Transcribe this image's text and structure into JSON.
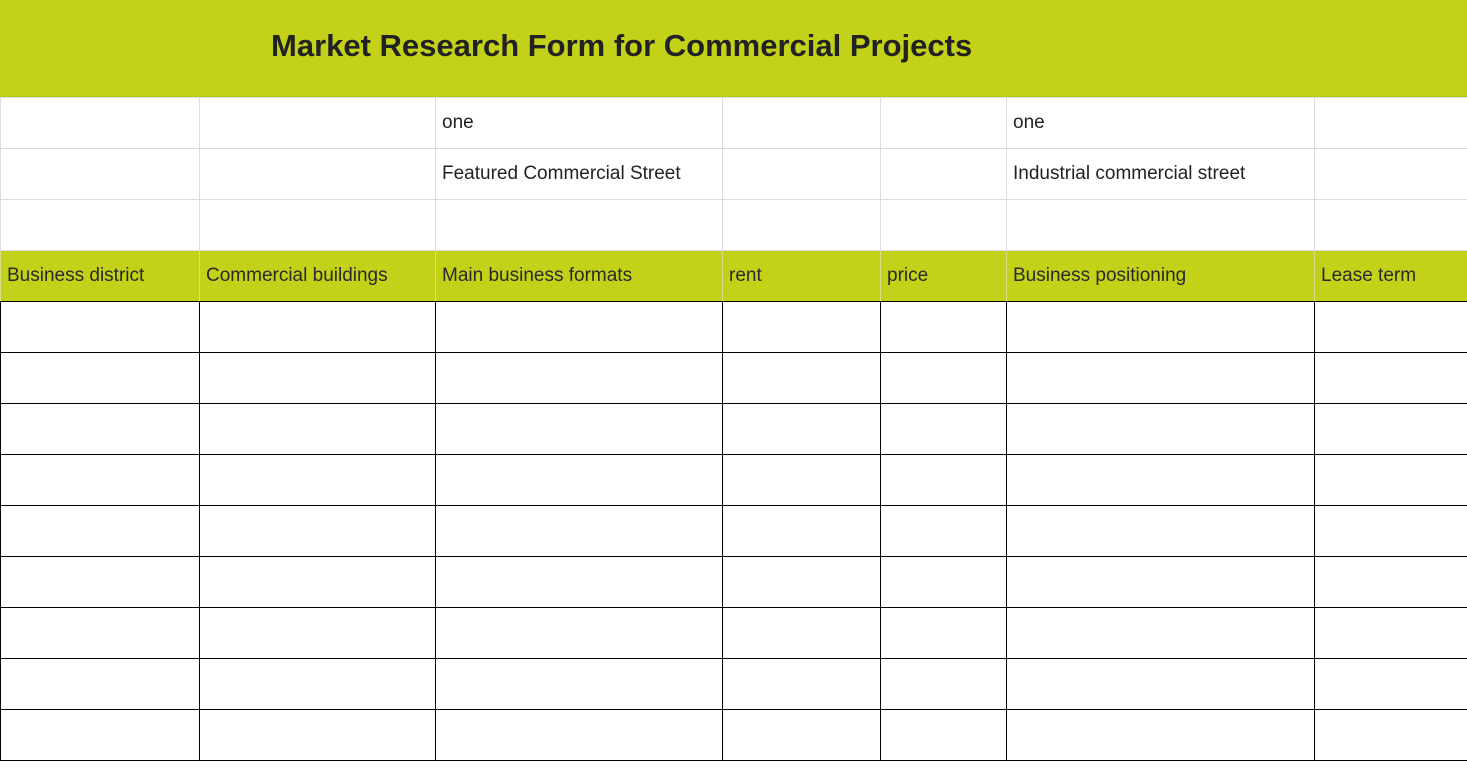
{
  "title": "Market Research Form for Commercial Projects",
  "colors": {
    "accent": "#c3d219",
    "grid_light": "#dcdcdc",
    "grid_dark": "#000000"
  },
  "info_rows": [
    [
      "",
      "",
      "one",
      "",
      "",
      "one",
      ""
    ],
    [
      "",
      "",
      "Featured Commercial Street",
      "",
      "",
      "Industrial commercial street",
      ""
    ],
    [
      "",
      "",
      "",
      "",
      "",
      "",
      ""
    ]
  ],
  "columns": [
    "Business district",
    "Commercial buildings",
    "Main business formats",
    "rent",
    "price",
    "Business positioning",
    "Lease term"
  ],
  "data_rows": [
    [
      "",
      "",
      "",
      "",
      "",
      "",
      ""
    ],
    [
      "",
      "",
      "",
      "",
      "",
      "",
      ""
    ],
    [
      "",
      "",
      "",
      "",
      "",
      "",
      ""
    ],
    [
      "",
      "",
      "",
      "",
      "",
      "",
      ""
    ],
    [
      "",
      "",
      "",
      "",
      "",
      "",
      ""
    ],
    [
      "",
      "",
      "",
      "",
      "",
      "",
      ""
    ],
    [
      "",
      "",
      "",
      "",
      "",
      "",
      ""
    ],
    [
      "",
      "",
      "",
      "",
      "",
      "",
      ""
    ],
    [
      "",
      "",
      "",
      "",
      "",
      "",
      ""
    ]
  ]
}
